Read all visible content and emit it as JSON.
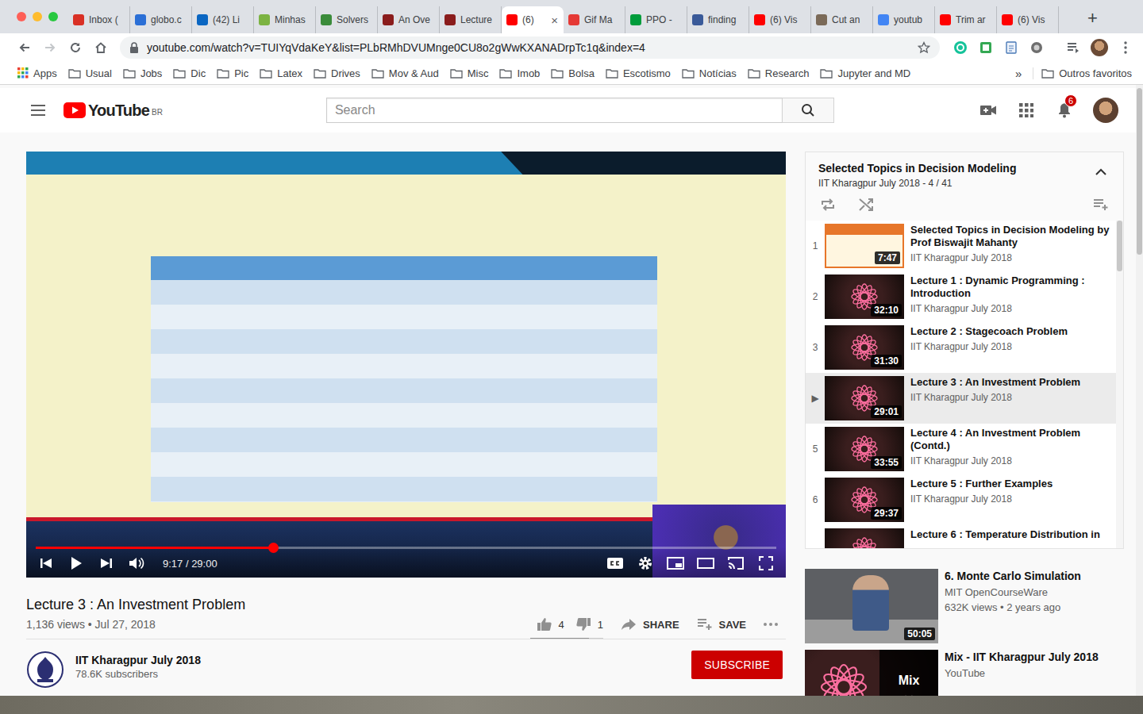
{
  "browser": {
    "tabs": [
      {
        "label": "Inbox (",
        "selected": false,
        "color": "#d93025"
      },
      {
        "label": "globo.c",
        "selected": false,
        "color": "#2b6fd6"
      },
      {
        "label": "(42) Li",
        "selected": false,
        "color": "#0a66c2"
      },
      {
        "label": "Minhas",
        "selected": false,
        "color": "#7cb342"
      },
      {
        "label": "Solvers",
        "selected": false,
        "color": "#3a8b3a"
      },
      {
        "label": "An Ove",
        "selected": false,
        "color": "#8a1c1c"
      },
      {
        "label": "Lecture",
        "selected": false,
        "color": "#8a1c1c"
      },
      {
        "label": "(6)",
        "selected": true,
        "color": "#ff0000"
      },
      {
        "label": "Gif Ma",
        "selected": false,
        "color": "#e53935"
      },
      {
        "label": "PPO -",
        "selected": false,
        "color": "#009c3b"
      },
      {
        "label": "finding",
        "selected": false,
        "color": "#3a5a99"
      },
      {
        "label": "(6) Vis",
        "selected": false,
        "color": "#ff0000"
      },
      {
        "label": "Cut an",
        "selected": false,
        "color": "#7b6a58"
      },
      {
        "label": "youtub",
        "selected": false,
        "color": "#4285f4"
      },
      {
        "label": "Trim ar",
        "selected": false,
        "color": "#ff0000"
      },
      {
        "label": "(6) Vis",
        "selected": false,
        "color": "#ff0000"
      }
    ],
    "close": "×",
    "new_tab": "+",
    "url": "youtube.com/watch?v=TUIYqVdaKeY&list=PLbRMhDVUMnge0CU8o2gWwKXANADrpTc1q&index=4",
    "bookmarks": [
      "Apps",
      "Usual",
      "Jobs",
      "Dic",
      "Pic",
      "Latex",
      "Drives",
      "Mov & Aud",
      "Misc",
      "Imob",
      "Bolsa",
      "Escotismo",
      "Notícias",
      "Research",
      "Jupyter and MD"
    ],
    "bookmarks_more": "»",
    "other_bookmarks": "Outros favoritos"
  },
  "youtube": {
    "logo": "YouTube",
    "region": "BR",
    "search": {
      "placeholder": "Search"
    },
    "notifications": "6"
  },
  "player": {
    "paused": true,
    "level": 0.32,
    "time": "9:17 / 29:00"
  },
  "video": {
    "title": "Lecture 3 : An Investment Problem",
    "meta": "1,136 views • Jul 27, 2018",
    "likes": "4",
    "dislikes": "1",
    "like_level": 0.8,
    "share": "SHARE",
    "save": "SAVE"
  },
  "channel": {
    "name": "IIT Kharagpur July 2018",
    "subscribers": "78.6K subscribers",
    "subscribe": "SUBSCRIBE"
  },
  "playlist": {
    "title": "Selected Topics in Decision Modeling",
    "subtitle": "IIT Kharagpur July 2018 - 4 / 41",
    "current_marker": "▶",
    "items": [
      {
        "index": "1",
        "title": "Selected Topics in Decision Modeling by Prof Biswajit Mahanty",
        "channel": "IIT Kharagpur July 2018",
        "duration": "7:47",
        "kind": "slide",
        "selected": false
      },
      {
        "index": "2",
        "title": "Lecture 1 : Dynamic Programming : Introduction",
        "channel": "IIT Kharagpur July 2018",
        "duration": "32:10",
        "kind": "logo",
        "selected": false
      },
      {
        "index": "3",
        "title": "Lecture 2 : Stagecoach Problem",
        "channel": "IIT Kharagpur July 2018",
        "duration": "31:30",
        "kind": "logo",
        "selected": false
      },
      {
        "index": "4",
        "title": "Lecture 3 : An Investment Problem",
        "channel": "IIT Kharagpur July 2018",
        "duration": "29:01",
        "kind": "logo",
        "selected": true
      },
      {
        "index": "5",
        "title": "Lecture 4 : An Investment Problem (Contd.)",
        "channel": "IIT Kharagpur July 2018",
        "duration": "33:55",
        "kind": "logo",
        "selected": false
      },
      {
        "index": "6",
        "title": "Lecture 5 : Further Examples",
        "channel": "IIT Kharagpur July 2018",
        "duration": "29:37",
        "kind": "logo",
        "selected": false
      },
      {
        "title": "Lecture 6 : Temperature Distribution in",
        "kind": "logo",
        "selected": false
      }
    ]
  },
  "recommended": [
    {
      "kind": "video",
      "title": "6. Monte Carlo Simulation",
      "channel": "MIT OpenCourseWare",
      "meta": "632K views • 2 years ago",
      "duration": "50:05"
    },
    {
      "kind": "mix",
      "title": "Mix - IIT Kharagpur July 2018",
      "channel": "YouTube",
      "overlay": "Mix"
    }
  ]
}
